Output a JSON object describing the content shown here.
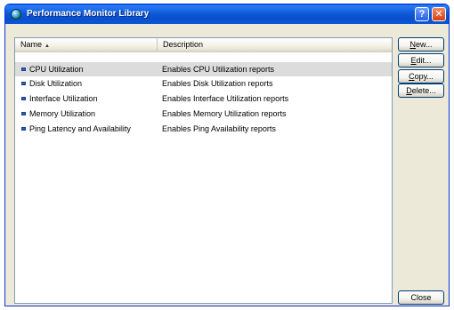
{
  "window": {
    "title": "Performance Monitor Library",
    "help_glyph": "?",
    "close_glyph": "✕"
  },
  "list": {
    "columns": [
      {
        "label": "Name",
        "sorted": "ascending"
      },
      {
        "label": "Description"
      }
    ],
    "sort_glyph": "▲",
    "rows": [
      {
        "name": "CPU Utilization",
        "description": "Enables CPU Utilization reports",
        "selected": true
      },
      {
        "name": "Disk Utilization",
        "description": "Enables Disk Utilization reports",
        "selected": false
      },
      {
        "name": "Interface Utilization",
        "description": "Enables Interface Utilization reports",
        "selected": false
      },
      {
        "name": "Memory Utilization",
        "description": "Enables Memory Utilization reports",
        "selected": false
      },
      {
        "name": "Ping Latency and Availability",
        "description": "Enables Ping Availability reports",
        "selected": false
      }
    ]
  },
  "buttons": {
    "new": {
      "mnemonic": "N",
      "rest": "ew..."
    },
    "edit": {
      "mnemonic": "E",
      "rest": "dit..."
    },
    "copy": {
      "mnemonic": "C",
      "rest": "opy..."
    },
    "delete": {
      "mnemonic": "D",
      "rest": "elete..."
    },
    "close": {
      "label": "Close"
    }
  },
  "colors": {
    "titlebar": "#0a4fcc",
    "selected_row": "#dcdcdc",
    "row_icon": "#2b5fb8"
  }
}
